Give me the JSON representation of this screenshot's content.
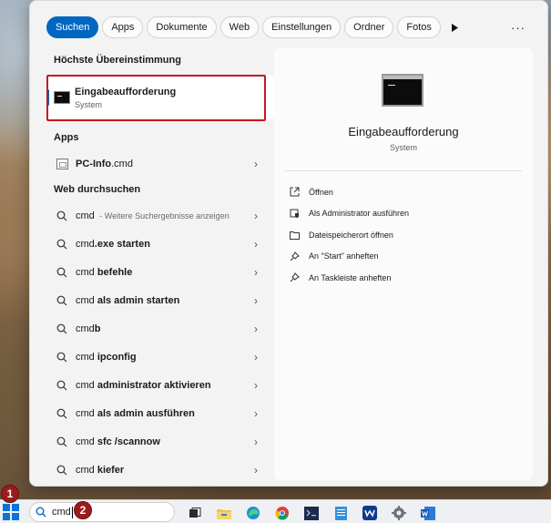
{
  "tabs": [
    "Suchen",
    "Apps",
    "Dokumente",
    "Web",
    "Einstellungen",
    "Ordner",
    "Fotos"
  ],
  "more_glyph": "▶",
  "ellipsis": "···",
  "best_match": {
    "heading": "Höchste Übereinstimmung",
    "name": "Eingabeaufforderung",
    "subtitle": "System"
  },
  "apps": {
    "heading": "Apps",
    "items": [
      {
        "bold": "PC-Info",
        "rest": ".cmd"
      }
    ]
  },
  "web": {
    "heading": "Web durchsuchen",
    "items": [
      {
        "normal": "cmd",
        "bold": "",
        "hint": " - Weitere Suchergebnisse anzeigen"
      },
      {
        "normal": "cmd",
        "bold": ".exe starten",
        "hint": ""
      },
      {
        "normal": "cmd",
        "bold": " befehle",
        "hint": ""
      },
      {
        "normal": "cmd",
        "bold": " als admin starten",
        "hint": ""
      },
      {
        "normal": "cmd",
        "bold": "b",
        "hint": ""
      },
      {
        "normal": "cmd",
        "bold": " ipconfig",
        "hint": ""
      },
      {
        "normal": "cmd",
        "bold": " administrator aktivieren",
        "hint": ""
      },
      {
        "normal": "cmd",
        "bold": " als admin ausführen",
        "hint": ""
      },
      {
        "normal": "cmd",
        "bold": " sfc /scannow",
        "hint": ""
      },
      {
        "normal": "cmd",
        "bold": " kiefer",
        "hint": ""
      }
    ]
  },
  "detail": {
    "title": "Eingabeaufforderung",
    "subtitle": "System",
    "actions": [
      {
        "label": "Öffnen",
        "icon": "open-external-icon"
      },
      {
        "label": "Als Administrator ausführen",
        "icon": "admin-shield-icon"
      },
      {
        "label": "Dateispeicherort öffnen",
        "icon": "folder-icon"
      },
      {
        "label": "An \"Start\" anheften",
        "icon": "pin-icon"
      },
      {
        "label": "An Taskleiste anheften",
        "icon": "pin-icon"
      }
    ]
  },
  "taskbar": {
    "search_text": "cmd",
    "badges": [
      "1",
      "2"
    ],
    "icons": [
      "task-view-icon",
      "file-explorer-icon",
      "edge-icon",
      "chrome-icon",
      "terminal-app-icon",
      "notepad-icon",
      "webex-icon",
      "settings-icon",
      "word-icon"
    ]
  },
  "colors": {
    "accent": "#0067c0",
    "highlight_border": "#c8161d",
    "badge": "#9b1c1c"
  }
}
